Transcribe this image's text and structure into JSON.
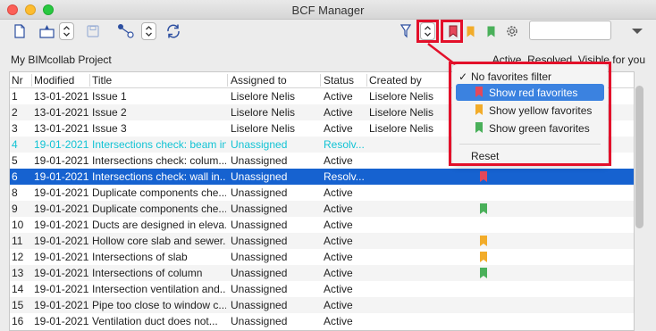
{
  "window": {
    "title": "BCF Manager"
  },
  "header": {
    "project": "My BIMcollab Project",
    "status_filter": "Active, Resolved, Visible for you"
  },
  "columns": [
    "Nr",
    "Modified",
    "Title",
    "Assigned to",
    "Status",
    "Created by"
  ],
  "rows": [
    {
      "nr": "1",
      "modified": "13-01-2021",
      "title": "Issue 1",
      "assigned": "Liselore Nelis",
      "status": "Active",
      "created": "Liselore Nelis",
      "flag": "",
      "style": ""
    },
    {
      "nr": "2",
      "modified": "13-01-2021",
      "title": "Issue 2",
      "assigned": "Liselore Nelis",
      "status": "Active",
      "created": "Liselore Nelis",
      "flag": "",
      "style": "alt"
    },
    {
      "nr": "3",
      "modified": "13-01-2021",
      "title": "Issue 3",
      "assigned": "Liselore Nelis",
      "status": "Active",
      "created": "Liselore Nelis",
      "flag": "",
      "style": ""
    },
    {
      "nr": "4",
      "modified": "19-01-2021",
      "title": "Intersections check: beam in...",
      "assigned": "Unassigned",
      "status": "Resolv...",
      "created": "",
      "flag": "",
      "style": "alt cyan"
    },
    {
      "nr": "5",
      "modified": "19-01-2021",
      "title": "Intersections check: colum...",
      "assigned": "Unassigned",
      "status": "Active",
      "created": "",
      "flag": "",
      "style": ""
    },
    {
      "nr": "6",
      "modified": "19-01-2021",
      "title": "Intersections check: wall in...",
      "assigned": "Unassigned",
      "status": "Resolv...",
      "created": "",
      "flag": "red",
      "style": "sel"
    },
    {
      "nr": "8",
      "modified": "19-01-2021",
      "title": "Duplicate components che...",
      "assigned": "Unassigned",
      "status": "Active",
      "created": "",
      "flag": "",
      "style": ""
    },
    {
      "nr": "9",
      "modified": "19-01-2021",
      "title": "Duplicate components che...",
      "assigned": "Unassigned",
      "status": "Active",
      "created": "",
      "flag": "green",
      "style": "alt"
    },
    {
      "nr": "10",
      "modified": "19-01-2021",
      "title": "Ducts are designed in eleva...",
      "assigned": "Unassigned",
      "status": "Active",
      "created": "",
      "flag": "",
      "style": ""
    },
    {
      "nr": "11",
      "modified": "19-01-2021",
      "title": "Hollow core slab and sewer...",
      "assigned": "Unassigned",
      "status": "Active",
      "created": "",
      "flag": "yellow",
      "style": "alt"
    },
    {
      "nr": "12",
      "modified": "19-01-2021",
      "title": "Intersections of slab",
      "assigned": "Unassigned",
      "status": "Active",
      "created": "",
      "flag": "yellow",
      "style": ""
    },
    {
      "nr": "13",
      "modified": "19-01-2021",
      "title": "Intersections of column",
      "assigned": "Unassigned",
      "status": "Active",
      "created": "",
      "flag": "green",
      "style": "alt"
    },
    {
      "nr": "14",
      "modified": "19-01-2021",
      "title": "Intersection ventilation and...",
      "assigned": "Unassigned",
      "status": "Active",
      "created": "",
      "flag": "",
      "style": ""
    },
    {
      "nr": "15",
      "modified": "19-01-2021",
      "title": "Pipe too close to window c...",
      "assigned": "Unassigned",
      "status": "Active",
      "created": "",
      "flag": "",
      "style": "alt"
    },
    {
      "nr": "16",
      "modified": "19-01-2021",
      "title": "Ventilation duct does not...",
      "assigned": "Unassigned",
      "status": "Active",
      "created": "",
      "flag": "",
      "style": ""
    }
  ],
  "menu": {
    "items": [
      {
        "label": "No favorites filter",
        "checked": true,
        "flag": ""
      },
      {
        "label": "Show red favorites",
        "checked": false,
        "flag": "red",
        "active": true
      },
      {
        "label": "Show yellow favorites",
        "checked": false,
        "flag": "yellow"
      },
      {
        "label": "Show green favorites",
        "checked": false,
        "flag": "green"
      }
    ],
    "reset": "Reset"
  },
  "colors": {
    "selection": "#1662d0",
    "highlight": "#e3102a",
    "resolved": "#11c3d4",
    "red_flag": "#e5485a",
    "yellow_flag": "#f2ac2a",
    "green_flag": "#4ab05a"
  }
}
